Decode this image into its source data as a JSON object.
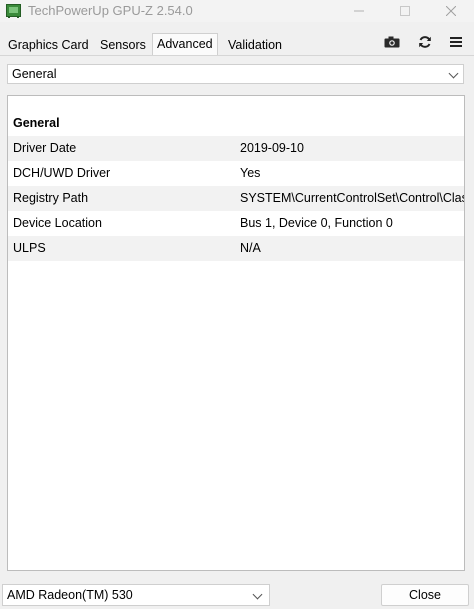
{
  "window": {
    "title": "TechPowerUp GPU-Z 2.54.0"
  },
  "tabs": [
    {
      "label": "Graphics Card",
      "active": false
    },
    {
      "label": "Sensors",
      "active": false
    },
    {
      "label": "Advanced",
      "active": true
    },
    {
      "label": "Validation",
      "active": false
    }
  ],
  "toolbar_icons": [
    "camera-icon",
    "refresh-icon",
    "menu-icon"
  ],
  "category_select": {
    "value": "General"
  },
  "section": {
    "title": "General",
    "rows": [
      {
        "key": "Driver Date",
        "value": "2019-09-10"
      },
      {
        "key": "DCH/UWD Driver",
        "value": "Yes"
      },
      {
        "key": "Registry Path",
        "value": "SYSTEM\\CurrentControlSet\\Control\\Clas"
      },
      {
        "key": "Device Location",
        "value": "Bus 1, Device 0, Function 0"
      },
      {
        "key": "ULPS",
        "value": "N/A"
      }
    ]
  },
  "footer": {
    "gpu_select": "AMD Radeon(TM) 530",
    "close_label": "Close"
  },
  "colors": {
    "row_alt": "#f2f2f2",
    "border": "#bcbcbc",
    "title_text": "#9a9a9a"
  }
}
